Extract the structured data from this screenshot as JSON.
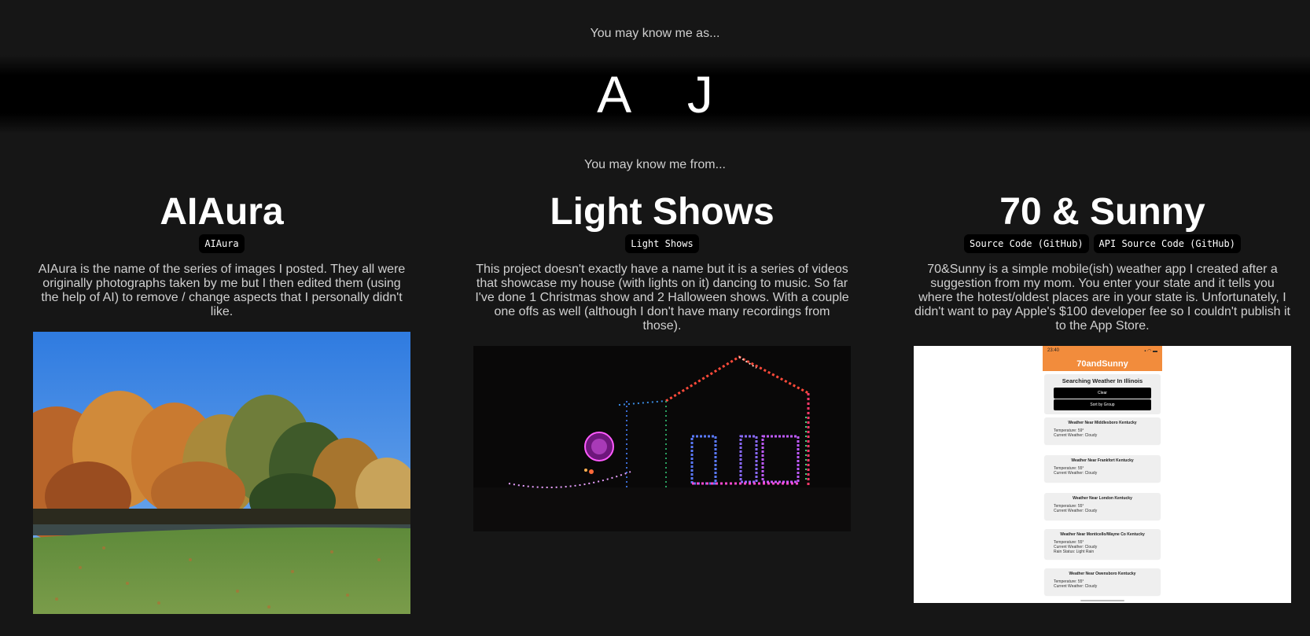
{
  "intro": {
    "as_text": "You may know me as...",
    "name": "A J",
    "from_text": "You may know me from..."
  },
  "projects": [
    {
      "title": "AIAura",
      "badges": [
        "AIAura"
      ],
      "description": "AIAura is the name of the series of images I posted. They all were originally photographs taken by me but I then edited them (using the help of AI) to remove / change aspects that I personally didn't like."
    },
    {
      "title": "Light Shows",
      "badges": [
        "Light Shows"
      ],
      "description": "This project doesn't exactly have a name but it is a series of videos that showcase my house (with lights on it) dancing to music. So far I've done 1 Christmas show and 2 Halloween shows. With a couple one offs as well (although I don't have many recordings from those)."
    },
    {
      "title": "70 & Sunny",
      "badges": [
        "Source Code (GitHub)",
        "API Source Code (GitHub)"
      ],
      "description": "70&Sunny is a simple mobile(ish) weather app I created after a suggestion from my mom. You enter your state and it tells you where the hotest/oldest places are in your state is. Unfortunately, I didn't want to pay Apple's $100 developer fee so I couldn't publish it to the App Store."
    }
  ],
  "phone": {
    "time": "23:40",
    "app_title": "70andSunny",
    "search_title": "Searching Weather In Illinois",
    "clear_label": "Clear",
    "sort_label": "Sort by Group",
    "cards": [
      {
        "title": "Weather Near Middlesboro Kentucky",
        "temp": "Temperature: 59°",
        "cond": "Current Weather: Cloudy",
        "extra": ""
      },
      {
        "title": "Weather Near Frankfort Kentucky",
        "temp": "Temperature: 55°",
        "cond": "Current Weather: Cloudy",
        "extra": ""
      },
      {
        "title": "Weather Near London Kentucky",
        "temp": "Temperature: 55°",
        "cond": "Current Weather: Cloudy",
        "extra": ""
      },
      {
        "title": "Weather Near Monticello/Wayne Co Kentucky",
        "temp": "Temperature: 55°",
        "cond": "Current Weather: Cloudy",
        "extra": "Rain Status: Light Rain"
      },
      {
        "title": "Weather Near Owensboro Kentucky",
        "temp": "Temperature: 55°",
        "cond": "Current Weather: Cloudy",
        "extra": ""
      }
    ]
  },
  "colors": {
    "background": "#161616",
    "band": "#000000",
    "badge": "#000000",
    "app_accent": "#f28c3c"
  }
}
